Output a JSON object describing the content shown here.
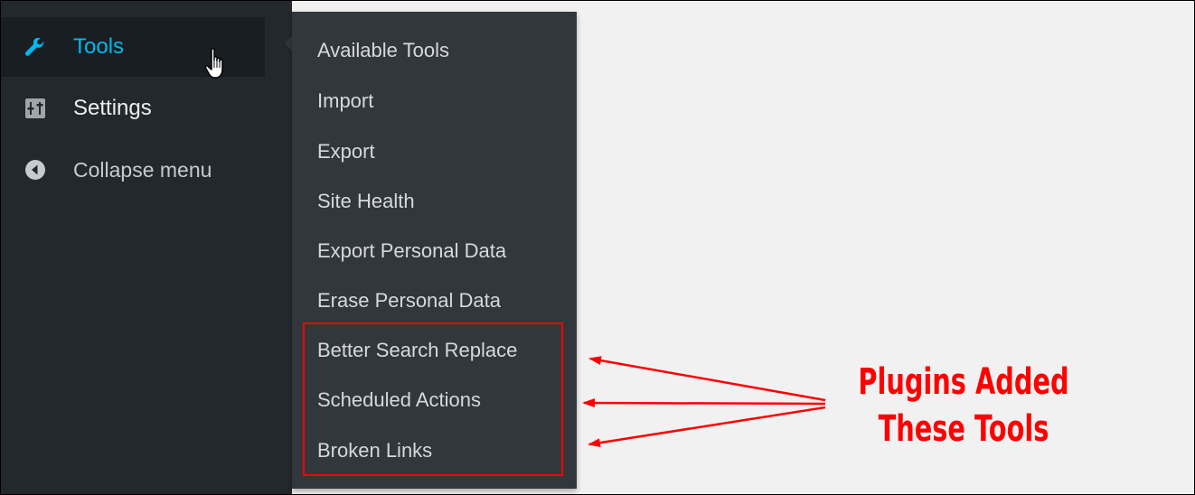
{
  "sidebar": {
    "items": [
      {
        "label": "Tools",
        "icon": "wrench-icon",
        "active": true
      },
      {
        "label": "Settings",
        "icon": "settings-sliders-icon",
        "active": false
      },
      {
        "label": "Collapse menu",
        "icon": "collapse-arrow-icon",
        "active": false
      }
    ]
  },
  "submenu": {
    "items": [
      "Available Tools",
      "Import",
      "Export",
      "Site Health",
      "Export Personal Data",
      "Erase Personal Data",
      "Better Search Replace",
      "Scheduled Actions",
      "Broken Links"
    ]
  },
  "annotation": {
    "line1": "Plugins Added",
    "line2": "These Tools"
  },
  "colors": {
    "sidebar_bg": "#23282d",
    "active_bg": "#191e23",
    "submenu_bg": "#32373c",
    "active_text": "#00b9eb",
    "highlight_red": "#ff0000",
    "content_bg": "#f1f1f1"
  }
}
